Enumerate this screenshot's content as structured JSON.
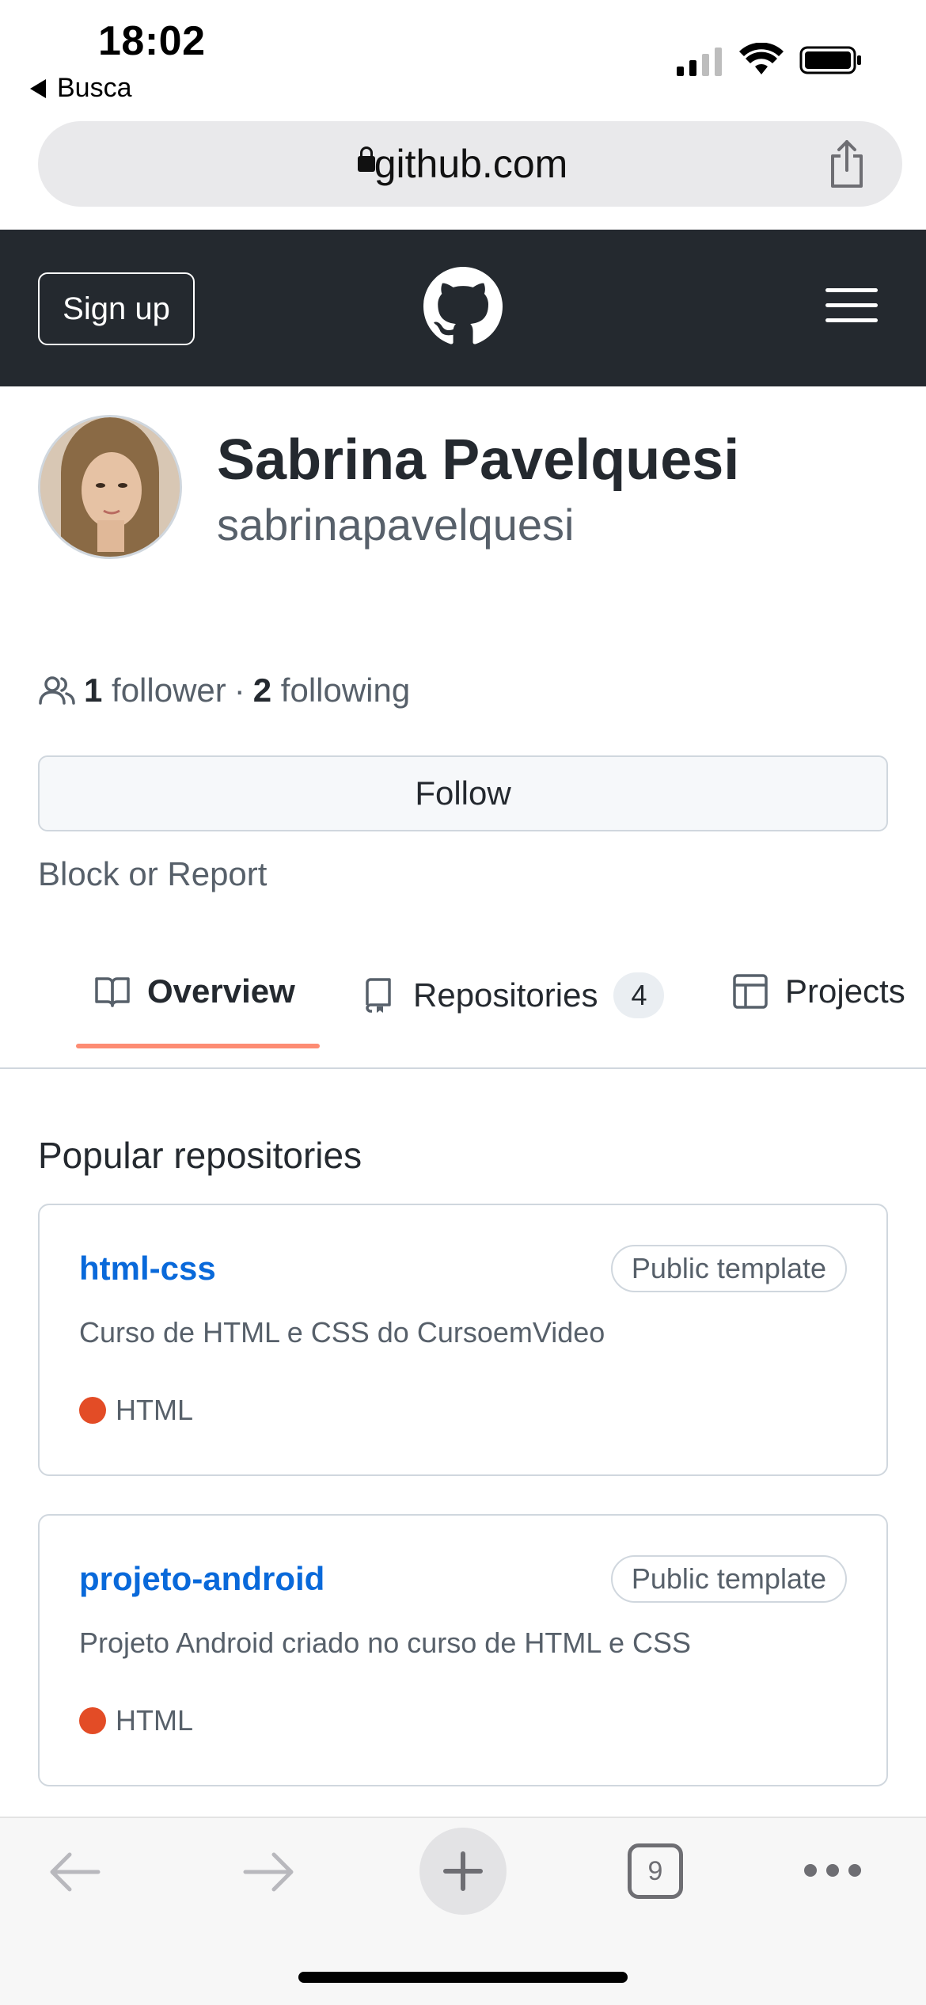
{
  "status_bar": {
    "time": "18:02",
    "back_app_label": "Busca"
  },
  "browser": {
    "url": "github.com"
  },
  "header": {
    "signup_label": "Sign up"
  },
  "profile": {
    "display_name": "Sabrina Pavelquesi",
    "username": "sabrinapavelquesi",
    "followers_count": "1",
    "followers_label": "follower",
    "separator": "·",
    "following_count": "2",
    "following_label": "following",
    "follow_button": "Follow",
    "block_report": "Block or Report"
  },
  "tabs": [
    {
      "label": "Overview",
      "icon": "book-icon",
      "selected": true
    },
    {
      "label": "Repositories",
      "icon": "repo-icon",
      "counter": "4"
    },
    {
      "label": "Projects",
      "icon": "table-icon"
    }
  ],
  "popular": {
    "title": "Popular repositories",
    "repos": [
      {
        "name": "html-css",
        "badge": "Public template",
        "description": "Curso de HTML e CSS do CursoemVideo",
        "language": "HTML",
        "language_color": "#e34c26"
      },
      {
        "name": "projeto-android",
        "badge": "Public template",
        "description": "Projeto Android criado no curso de HTML e CSS",
        "language": "HTML",
        "language_color": "#e34c26"
      }
    ]
  },
  "toolbar": {
    "tab_count": "9"
  },
  "colors": {
    "header_bg": "#24292f",
    "link": "#0969da",
    "tab_underline": "#fd8c73"
  }
}
